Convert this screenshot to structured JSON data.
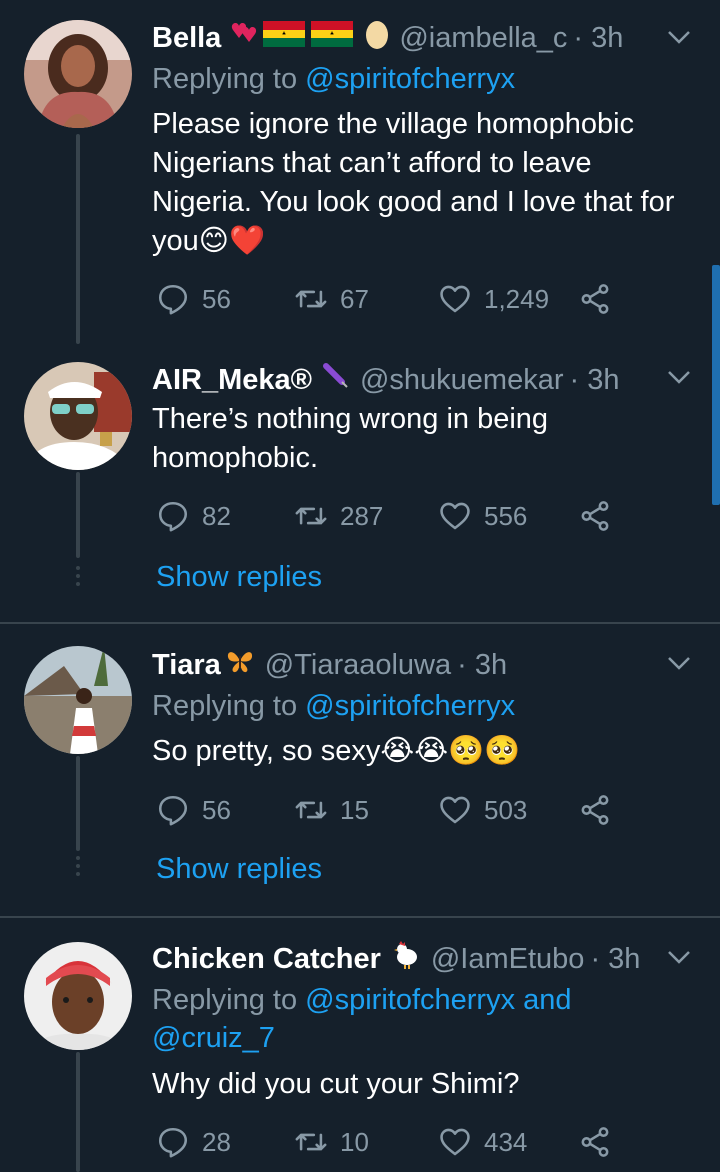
{
  "tweets": [
    {
      "name": "Bella",
      "handle": "@iambella_c",
      "time": "· 3h",
      "replying_prefix": "Replying to ",
      "replying_to": "@spiritofcherryx",
      "replying_and": "",
      "replying_to2": "",
      "text": "Please ignore the village homophobic Nigerians that can’t afford to leave Nigeria. You look good and I love that for you😊❤️",
      "replies": "56",
      "retweets": "67",
      "likes": "1,249",
      "avatar_icon": "avatar-woman-pink"
    },
    {
      "name": "AIR_Meka®",
      "handle": "@shukuemekar",
      "time": "· 3h",
      "text": "There’s nothing wrong in being homophobic.",
      "replies": "82",
      "retweets": "287",
      "likes": "556",
      "show_replies": "Show replies",
      "avatar_icon": "avatar-man-glasses"
    },
    {
      "name": "Tiara",
      "handle": "@Tiaraaoluwa",
      "time": "· 3h",
      "replying_prefix": "Replying to ",
      "replying_to": "@spiritofcherryx",
      "text": "So pretty, so sexy😭😭🥺🥺",
      "replies": "56",
      "retweets": "15",
      "likes": "503",
      "show_replies": "Show replies",
      "avatar_icon": "avatar-beach"
    },
    {
      "name": "Chicken Catcher",
      "handle": "@IamEtubo",
      "time": "· 3h",
      "replying_prefix": "Replying to ",
      "replying_to": "@spiritofcherryx",
      "replying_and": " and",
      "replying_to2": "@cruiz_7",
      "text": "Why did you cut your Shimi?",
      "replies": "28",
      "retweets": "10",
      "likes": "434",
      "avatar_icon": "avatar-man-red-cap"
    }
  ],
  "colors": {
    "background": "#15202b",
    "secondary_text": "#8899a6",
    "link": "#1da1f2",
    "divider": "#38444d"
  }
}
